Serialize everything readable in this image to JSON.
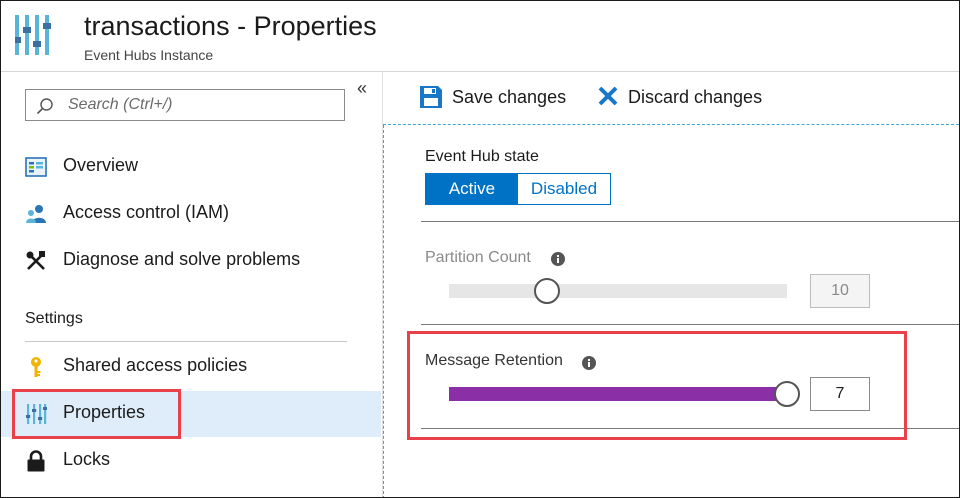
{
  "header": {
    "title": "transactions - Properties",
    "subtitle": "Event Hubs Instance",
    "icon": "event-hubs-properties-icon"
  },
  "sidebar": {
    "collapse_label": "«",
    "search": {
      "placeholder": "Search (Ctrl+/)",
      "value": ""
    },
    "items": [
      {
        "label": "Overview",
        "icon": "overview-icon"
      },
      {
        "label": "Access control (IAM)",
        "icon": "access-control-icon"
      },
      {
        "label": "Diagnose and solve problems",
        "icon": "wrench-icon"
      }
    ],
    "settings_section": {
      "label": "Settings",
      "items": [
        {
          "label": "Shared access policies",
          "icon": "key-icon",
          "active": false
        },
        {
          "label": "Properties",
          "icon": "properties-icon",
          "active": true
        },
        {
          "label": "Locks",
          "icon": "lock-icon",
          "active": false
        }
      ]
    }
  },
  "toolbar": {
    "save_label": "Save changes",
    "discard_label": "Discard changes"
  },
  "form": {
    "event_hub_state": {
      "label": "Event Hub state",
      "options": [
        "Active",
        "Disabled"
      ],
      "selected": "Active"
    },
    "partition_count": {
      "label": "Partition Count",
      "value": "10",
      "min": 1,
      "max": 32,
      "disabled": true
    },
    "message_retention": {
      "label": "Message Retention",
      "value": "7",
      "min": 1,
      "max": 7
    }
  },
  "colors": {
    "accent": "#0072c6",
    "slider_fill": "#8b2fa6",
    "highlight": "#e8414a",
    "active_nav_bg": "#dfedfa"
  }
}
